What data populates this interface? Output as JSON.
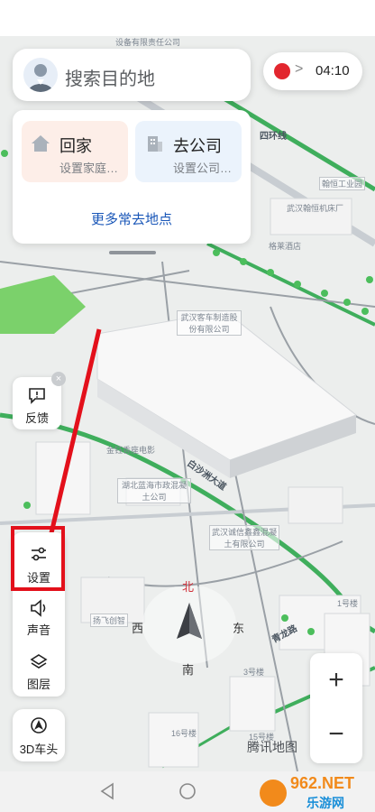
{
  "search": {
    "placeholder": "搜索目的地"
  },
  "shortcuts": [
    {
      "label": "回家",
      "sub": "设置家庭…"
    },
    {
      "label": "去公司",
      "sub": "设置公司…"
    }
  ],
  "more_places": "更多常去地点",
  "time_pill": {
    "time": "04:10",
    "chevron": ">"
  },
  "side_buttons": {
    "feedback": "反馈",
    "settings": "设置",
    "sound": "声音",
    "layers": "图层",
    "car_3d": "3D车头"
  },
  "compass": {
    "north": "北",
    "south": "南",
    "east": "东",
    "west": "西"
  },
  "zoom": {
    "in": "+",
    "out": "−"
  },
  "brand": "腾讯地图",
  "map_labels": [
    "设备有限责任公司",
    "四环线",
    "翰恒工业园",
    "武汉翰恒机床厂",
    "格莱酒店",
    "武汉客车制造股份有限公司",
    "湖北蓝海市政混凝土公司",
    "金钰香座电影",
    "扬飞创智",
    "武汉诚信鑫鑫混凝土有限公司",
    "3号楼",
    "15号楼",
    "16号楼",
    "1号楼",
    "青龙路",
    "白沙洲大道"
  ],
  "watermark": {
    "brand": "962.NET",
    "tagline": "乐游网"
  },
  "colors": {
    "accent_red": "#e3101b",
    "link_blue": "#1a57b8",
    "road_green": "#3fae5c"
  }
}
